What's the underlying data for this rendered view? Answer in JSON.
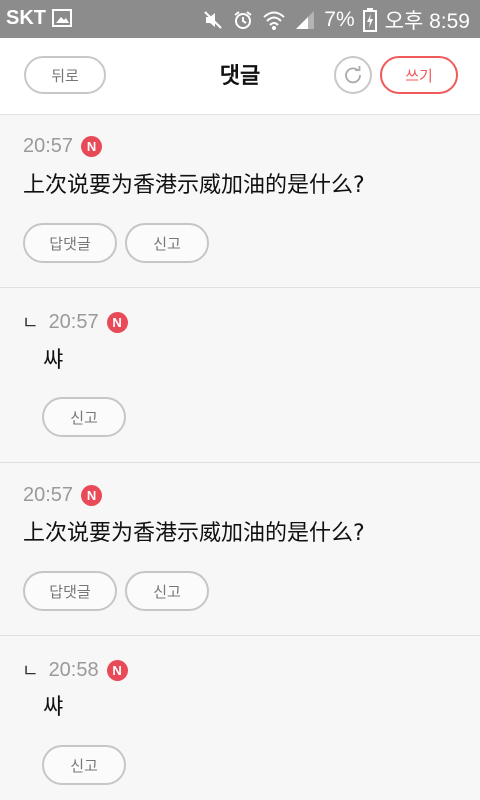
{
  "statusbar": {
    "carrier": "SKT",
    "battery": "7%",
    "time": "오후 8:59"
  },
  "header": {
    "back_label": "뒤로",
    "title": "댓글",
    "write_label": "쓰기"
  },
  "comments": [
    {
      "time": "20:57",
      "badge": "N",
      "text": "上次说要为香港示威加油的是什么?",
      "reply_label": "답댓글",
      "report_label": "신고"
    },
    {
      "reply_mark": "ㄴ",
      "time": "20:57",
      "badge": "N",
      "text": "쌰",
      "report_label": "신고"
    },
    {
      "time": "20:57",
      "badge": "N",
      "text": "上次说要为香港示威加油的是什么?",
      "reply_label": "답댓글",
      "report_label": "신고"
    },
    {
      "reply_mark": "ㄴ",
      "time": "20:58",
      "badge": "N",
      "text": "쌰",
      "report_label": "신고"
    }
  ],
  "colors": {
    "accent": "#f05a5a",
    "new_badge": "#e94a57",
    "statusbar": "#8c8c8c"
  },
  "icons": [
    "gallery-icon",
    "mute-icon",
    "alarm-icon",
    "wifi-icon",
    "signal-icon",
    "battery-charging-icon",
    "refresh-icon",
    "new-badge"
  ]
}
